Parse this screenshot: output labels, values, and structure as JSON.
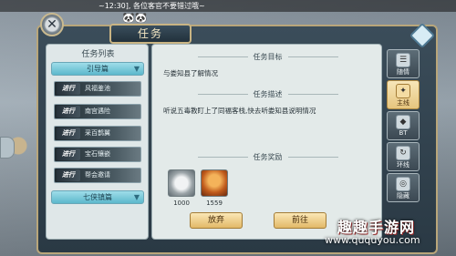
{
  "broadcast": "~12:30], 各位客官不要错过哦~",
  "window": {
    "title": "任务",
    "deco": "🐼🐼"
  },
  "quest_list": {
    "title": "任务列表",
    "category_top": "引导篇",
    "items": [
      {
        "tag": "进行",
        "name": "风福鉴池"
      },
      {
        "tag": "进行",
        "name": "南宫遇险"
      },
      {
        "tag": "进行",
        "name": "采百鹊翼"
      },
      {
        "tag": "进行",
        "name": "宝石镶嵌"
      },
      {
        "tag": "进行",
        "name": "帮会邀请"
      }
    ],
    "category_bottom": "七侠镇篇"
  },
  "detail": {
    "goal_header": "任务目标",
    "goal_text": "与娄知县了解情况",
    "desc_header": "任务描述",
    "desc_text": "听说五毒教盯上了同福客栈,快去听娄知县说明情况",
    "reward_header": "任务奖励",
    "rewards": [
      {
        "name": "silver-coin",
        "count": "1000"
      },
      {
        "name": "gold-bell",
        "count": "1559"
      }
    ],
    "abandon_label": "放弃",
    "goto_label": "前往"
  },
  "tabs": [
    {
      "label": "随情",
      "icon": "chat-icon"
    },
    {
      "label": "主线",
      "icon": "scroll-icon",
      "active": true
    },
    {
      "label": "BT",
      "icon": "bt-icon"
    },
    {
      "label": "环线",
      "icon": "loop-icon"
    },
    {
      "label": "隐藏",
      "icon": "hidden-icon"
    }
  ],
  "watermark": {
    "name": "趣趣手游网",
    "url": "www.ququyou.com"
  }
}
